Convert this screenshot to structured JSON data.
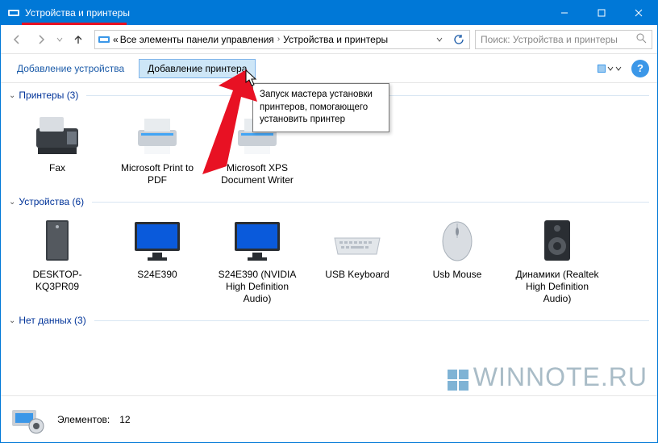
{
  "window": {
    "title": "Устройства и принтеры"
  },
  "breadcrumb": {
    "prefix": "«",
    "parent": "Все элементы панели управления",
    "current": "Устройства и принтеры"
  },
  "search": {
    "placeholder": "Поиск: Устройства и принтеры"
  },
  "toolbar": {
    "add_device": "Добавление устройства",
    "add_printer": "Добавление принтера"
  },
  "tooltip": {
    "text": "Запуск мастера установки принтеров, помогающего установить принтер"
  },
  "groups": {
    "printers": {
      "title": "Принтеры (3)",
      "items": [
        {
          "label": "Fax"
        },
        {
          "label": "Microsoft Print to PDF"
        },
        {
          "label": "Microsoft XPS Document Writer"
        }
      ]
    },
    "devices": {
      "title": "Устройства (6)",
      "items": [
        {
          "label": "DESKTOP-KQ3PR09"
        },
        {
          "label": "S24E390"
        },
        {
          "label": "S24E390 (NVIDIA High Definition Audio)"
        },
        {
          "label": "USB Keyboard"
        },
        {
          "label": "Usb Mouse"
        },
        {
          "label": "Динамики (Realtek High Definition Audio)"
        }
      ]
    },
    "nodata": {
      "title": "Нет данных (3)"
    }
  },
  "status": {
    "elements_label": "Элементов:",
    "elements_count": "12"
  },
  "watermark": {
    "text": "WINNOTE.RU"
  }
}
